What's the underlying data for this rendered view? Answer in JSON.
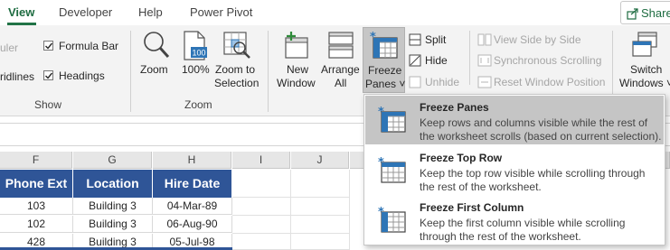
{
  "tabs": {
    "view": "View",
    "developer": "Developer",
    "help": "Help",
    "power_pivot": "Power Pivot",
    "share": "Share"
  },
  "show_group": {
    "ruler": "uler",
    "formula_bar": "Formula Bar",
    "gridlines": "ridlines",
    "headings": "Headings",
    "label": "Show"
  },
  "zoom_group": {
    "zoom": "Zoom",
    "zoom100": "100%",
    "zoom_to_l1": "Zoom to",
    "zoom_to_l2": "Selection",
    "label": "Zoom",
    "icon_100_text": "100"
  },
  "window_group": {
    "new_l1": "New",
    "new_l2": "Window",
    "arrange_l1": "Arrange",
    "arrange_l2": "All",
    "freeze_l1": "Freeze",
    "freeze_l2": "Panes ˅",
    "split": "Split",
    "hide": "Hide",
    "unhide": "Unhide",
    "side_by_side": "View Side by Side",
    "sync_scrolling": "Synchronous Scrolling",
    "reset_position": "Reset Window Position",
    "switch_l1": "Switch",
    "switch_l2": "Windows ˅"
  },
  "columns": [
    "F",
    "G",
    "H",
    "I",
    "J"
  ],
  "table": {
    "headers": [
      "Phone Ext",
      "Location",
      "Hire Date"
    ],
    "rows": [
      [
        "103",
        "Building 3",
        "04-Mar-89"
      ],
      [
        "102",
        "Building 3",
        "06-Aug-90"
      ],
      [
        "428",
        "Building 3",
        "05-Jul-98"
      ]
    ]
  },
  "freeze_menu": {
    "items": [
      {
        "title": "Freeze Panes",
        "d1": "Keep rows and columns visible while the rest of",
        "d2": "the worksheet scrolls (based on current selection)."
      },
      {
        "title": "Freeze Top Row",
        "d1": "Keep the top row visible while scrolling through",
        "d2": "the rest of the worksheet."
      },
      {
        "title": "Freeze First Column",
        "d1": "Keep the first column visible while scrolling",
        "d2": "through the rest of the worksheet."
      }
    ]
  },
  "colors": {
    "accent_green": "#217346",
    "table_header": "#2f5597",
    "menu_highlight": "#c5c5c5",
    "icon_blue": "#2e75b6"
  }
}
